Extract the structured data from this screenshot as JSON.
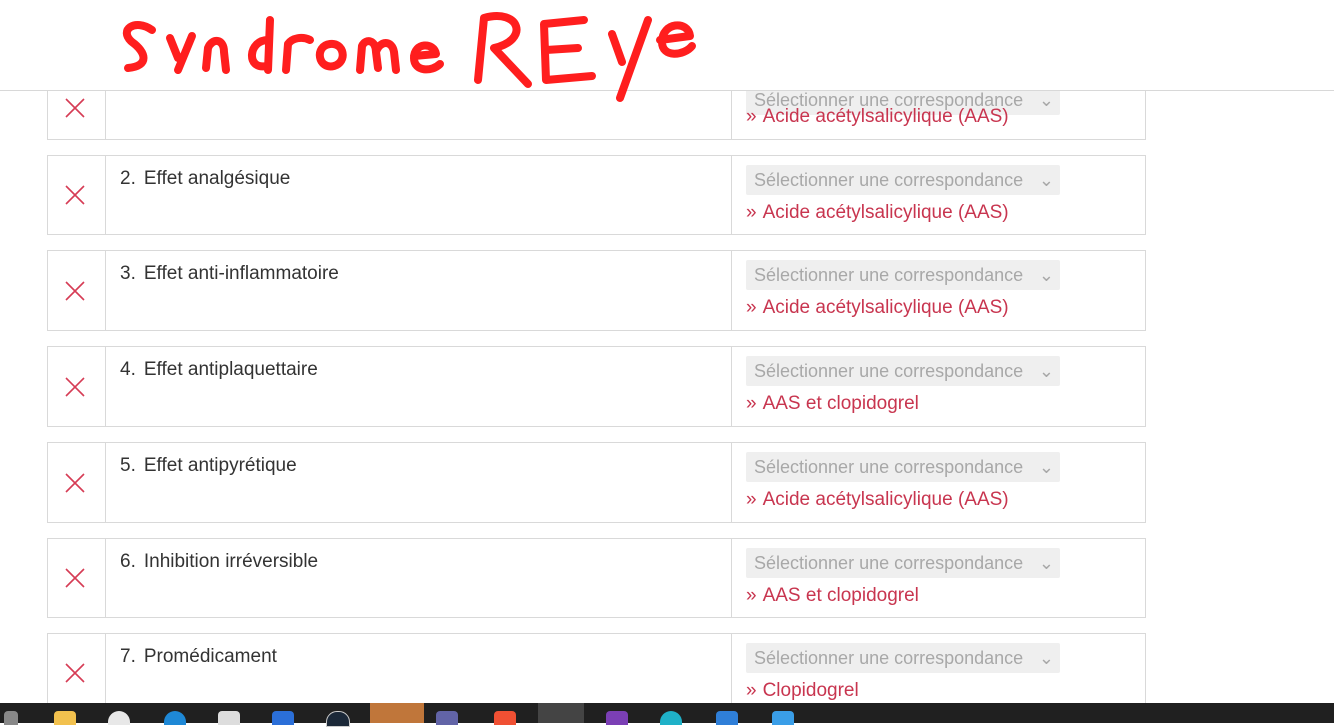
{
  "annotation": {
    "handwriting": "syndrome Reye",
    "color": "#ff1e1e"
  },
  "select_placeholder": "Sélectionner une correspondance",
  "rows": [
    {
      "number": "",
      "question": "",
      "answer": "Acide acétylsalicylique (AAS)"
    },
    {
      "number": "2.",
      "question": "Effet analgésique",
      "answer": "Acide acétylsalicylique (AAS)"
    },
    {
      "number": "3.",
      "question": "Effet anti-inflammatoire",
      "answer": "Acide acétylsalicylique (AAS)"
    },
    {
      "number": "4.",
      "question": "Effet antiplaquettaire",
      "answer": "AAS et clopidogrel"
    },
    {
      "number": "5.",
      "question": "Effet antipyrétique",
      "answer": "Acide acétylsalicylique (AAS)"
    },
    {
      "number": "6.",
      "question": "Inhibition irréversible",
      "answer": "AAS et clopidogrel"
    },
    {
      "number": "7.",
      "question": "Promédicament",
      "answer": "Clopidogrel"
    }
  ],
  "colors": {
    "incorrect": "#d63c55",
    "answer": "#c8354f",
    "taskbar": "#202020"
  },
  "taskbar_icons": [
    "search-icon",
    "file-explorer-icon",
    "chrome-icon",
    "edge-icon",
    "store-icon",
    "word-icon",
    "steam-icon",
    "spotify-icon",
    "teams-icon",
    "git-icon",
    "powerpoint-icon",
    "onenote-icon",
    "browser-icon",
    "calendar-icon",
    "windows-icon"
  ]
}
